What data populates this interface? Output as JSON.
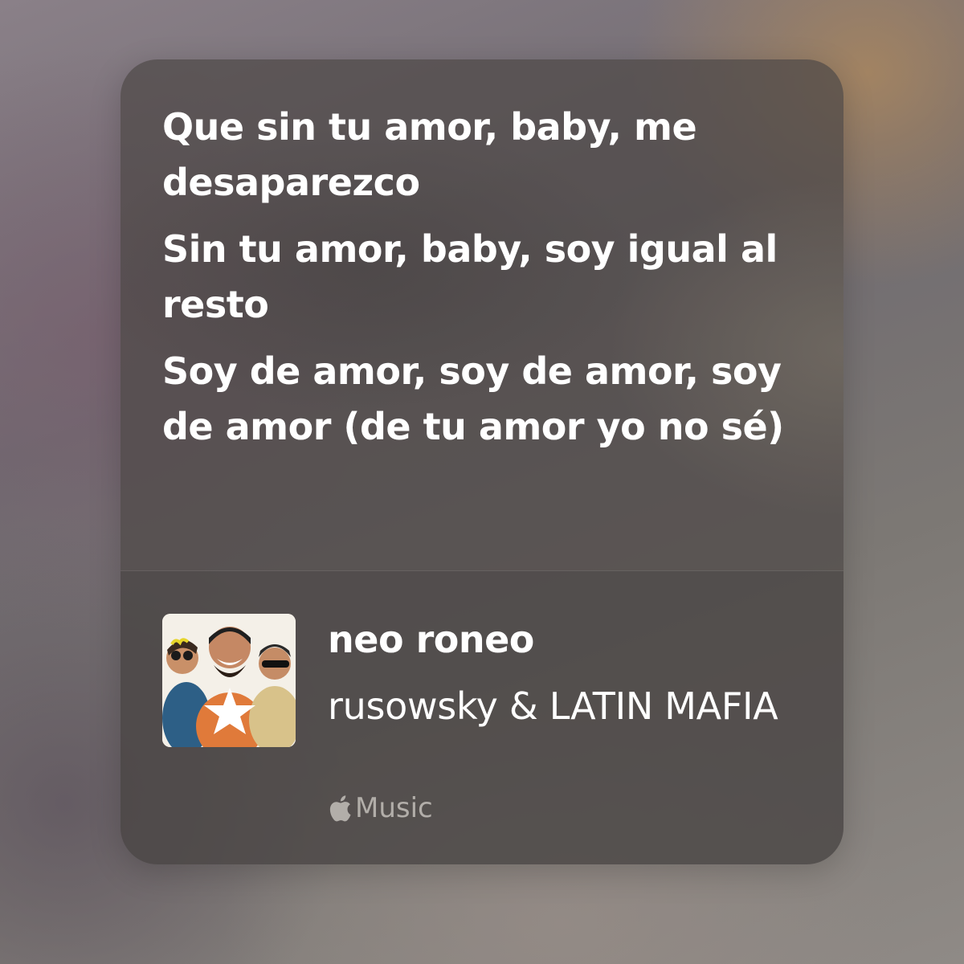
{
  "lyrics": {
    "lines": [
      "Que sin tu amor, baby, me desaparezco",
      "Sin tu amor, baby, soy igual al resto",
      "Soy de amor, soy de amor, soy de amor (de tu amor yo no sé)"
    ]
  },
  "song": {
    "title": "neo roneo",
    "artist": "rusowsky & LATIN MAFIA",
    "artwork_icon": "album-artwork-three-people-with-star"
  },
  "service": {
    "icon": "apple-logo-icon",
    "label": "Music"
  },
  "colors": {
    "text_primary": "#ffffff",
    "text_secondary": "#d2cdc8",
    "card_background": "#4e4846"
  }
}
